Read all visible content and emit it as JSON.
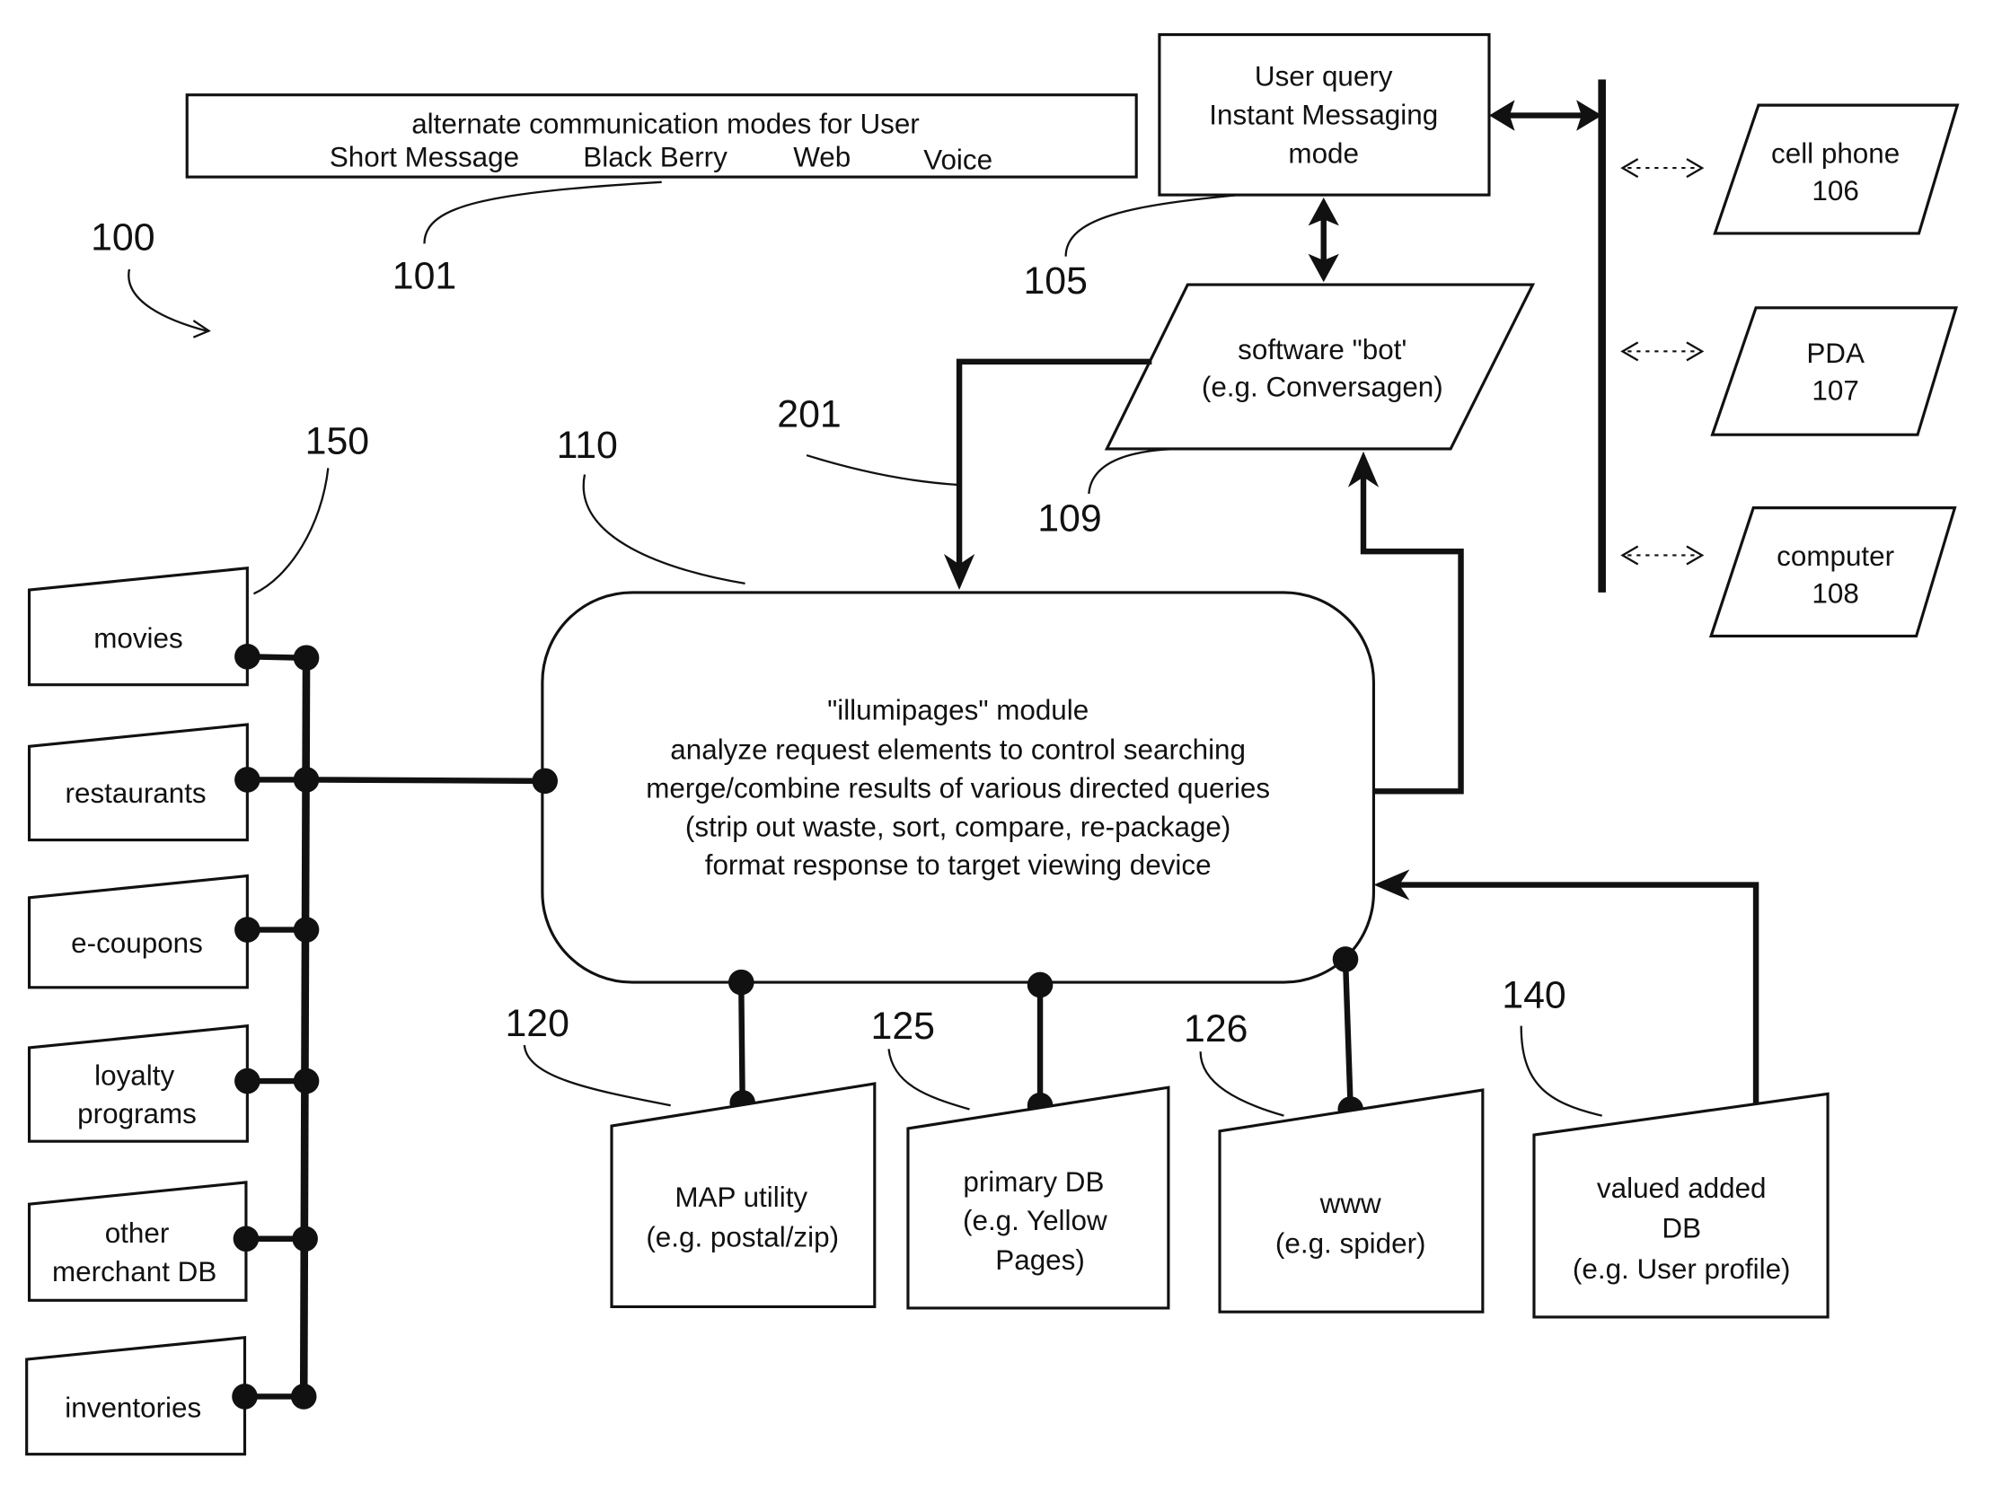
{
  "figure": {
    "id_label": "100",
    "comm_modes": {
      "ref": "101",
      "title": "alternate communication modes for User",
      "modes": [
        "Short Message",
        "Black Berry",
        "Web",
        "Voice"
      ]
    },
    "user_query": {
      "ref": "105",
      "lines": [
        "User query",
        "Instant Messaging",
        "mode"
      ]
    },
    "devices": [
      {
        "name": "cell phone",
        "ref": "106"
      },
      {
        "name": "PDA",
        "ref": "107"
      },
      {
        "name": "computer",
        "ref": "108"
      }
    ],
    "bot": {
      "ref": "109",
      "lines": [
        "software \"bot'",
        "(e.g. Conversagen)"
      ]
    },
    "bot_link_ref": "201",
    "module": {
      "ref": "110",
      "lines": [
        "\"illumipages\" module",
        "analyze request elements to control searching",
        "merge/combine results of various directed queries",
        "(strip out waste, sort, compare, re-package)",
        "format response to target viewing device"
      ]
    },
    "merchant_dbs": {
      "ref": "150",
      "items": [
        {
          "lines": [
            "movies"
          ]
        },
        {
          "lines": [
            "restaurants"
          ]
        },
        {
          "lines": [
            "e-coupons"
          ]
        },
        {
          "lines": [
            "loyalty",
            "programs"
          ]
        },
        {
          "lines": [
            "other",
            "merchant DB"
          ]
        },
        {
          "lines": [
            "inventories"
          ]
        }
      ]
    },
    "data_sources": [
      {
        "ref": "120",
        "lines": [
          "MAP utility",
          "(e.g. postal/zip)"
        ]
      },
      {
        "ref": "125",
        "lines": [
          "primary DB",
          "(e.g. Yellow",
          "Pages)"
        ]
      },
      {
        "ref": "126",
        "lines": [
          "www",
          "(e.g. spider)"
        ]
      },
      {
        "ref": "140",
        "lines": [
          "valued added",
          "DB",
          "(e.g. User profile)"
        ]
      }
    ]
  }
}
